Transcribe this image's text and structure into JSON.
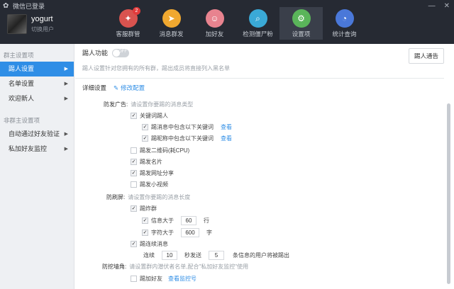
{
  "window": {
    "title": "微信已登录",
    "minimize": "—",
    "close": "✕"
  },
  "profile": {
    "name": "yogurt",
    "switch_user": "切换用户"
  },
  "nav": [
    {
      "label": "客服群管",
      "badge": "2",
      "color": "#d9534f",
      "icon": "✦"
    },
    {
      "label": "消息群发",
      "color": "#f0a830",
      "icon": "➤"
    },
    {
      "label": "加好友",
      "color": "#e8838f",
      "icon": "☺"
    },
    {
      "label": "检测僵尸粉",
      "color": "#3aa9d6",
      "icon": "⌕"
    },
    {
      "label": "设置项",
      "color": "#5ab55a",
      "icon": "⚙"
    },
    {
      "label": "统计查询",
      "color": "#4a78d9",
      "icon": "◔"
    }
  ],
  "sidebar": {
    "group1": "群主设置项",
    "items1": [
      "踢人设置",
      "名单设置",
      "欢迎新人"
    ],
    "group2": "非群主设置项",
    "items2": [
      "自动通过好友验证",
      "私加好友监控"
    ]
  },
  "main": {
    "kick_label": "踢人功能",
    "toggle_text": "OFF",
    "notice_button": "踢人通告",
    "description": "踢人设置针对您拥有的所有群，踢出成员将直接列入黑名单",
    "detail_label": "详细设置",
    "edit_link": "修改配置"
  },
  "ads": {
    "label": "防发广告:",
    "hint": "请设置你要踢的消息类型",
    "keyword": "关键词踢人",
    "msg_keyword": "踢消息中包含以下关键词",
    "nick_keyword": "踢昵称中包含以下关键词",
    "view": "查看",
    "qr": "踢发二维码(耗CPU)",
    "card": "踢发名片",
    "link": "踢发网址分享",
    "video": "踢发小视频"
  },
  "flood": {
    "label": "防刷屏:",
    "hint": "请设置你要踢的消息长度",
    "kick_group": "踢炸群",
    "info_over": "信息大于",
    "info_value": "60",
    "info_unit": "行",
    "char_over": "字符大于",
    "char_value": "600",
    "char_unit": "字",
    "continuous": "踢连续消息",
    "consecutive": "连续",
    "seconds_value": "10",
    "seconds_text": "秒发送",
    "count_value": "5",
    "count_text": "条信息的用户将被踢出"
  },
  "poach": {
    "label": "防挖墙角:",
    "hint": "请设置群内潜伏者名单,配合\"私加好友监控\"使用",
    "add_friend": "踢加好友",
    "view_monitor": "查看监控号"
  }
}
